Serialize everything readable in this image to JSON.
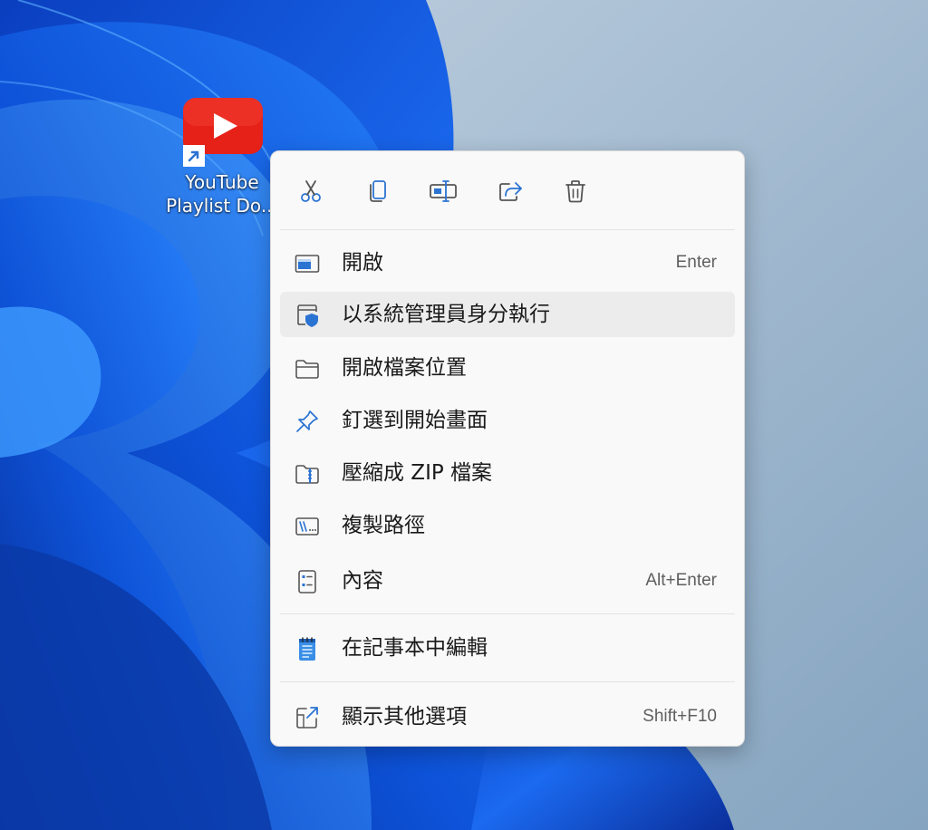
{
  "desktop": {
    "icon": {
      "icon_name": "youtube-logo",
      "badge_icon": "shortcut-arrow-icon",
      "label_line1": "YouTube",
      "label_line2": "Playlist Do..."
    }
  },
  "context_menu": {
    "toolbar": [
      {
        "name": "cut",
        "icon": "scissors-icon"
      },
      {
        "name": "copy",
        "icon": "copy-icon"
      },
      {
        "name": "rename",
        "icon": "rename-icon"
      },
      {
        "name": "share",
        "icon": "share-icon"
      },
      {
        "name": "delete",
        "icon": "trash-icon"
      }
    ],
    "items": [
      {
        "label": "開啟",
        "shortcut": "Enter",
        "icon": "window-open-icon"
      },
      {
        "label": "以系統管理員身分執行",
        "shortcut": "",
        "icon": "admin-shield-icon"
      },
      {
        "label": "開啟檔案位置",
        "shortcut": "",
        "icon": "folder-icon"
      },
      {
        "label": "釘選到開始畫面",
        "shortcut": "",
        "icon": "pin-icon"
      },
      {
        "label": "壓縮成 ZIP 檔案",
        "shortcut": "",
        "icon": "zip-folder-icon"
      },
      {
        "label": "複製路徑",
        "shortcut": "",
        "icon": "copy-path-icon"
      },
      {
        "label": "內容",
        "shortcut": "Alt+Enter",
        "icon": "properties-icon"
      },
      {
        "label": "在記事本中編輯",
        "shortcut": "",
        "icon": "notepad-icon"
      },
      {
        "label": "顯示其他選項",
        "shortcut": "Shift+F10",
        "icon": "more-options-icon"
      }
    ]
  },
  "colors": {
    "accent": "#2b73d3",
    "menu_bg": "#f9f9f9",
    "hover_bg": "#ececec",
    "youtube_red": "#e62117"
  }
}
